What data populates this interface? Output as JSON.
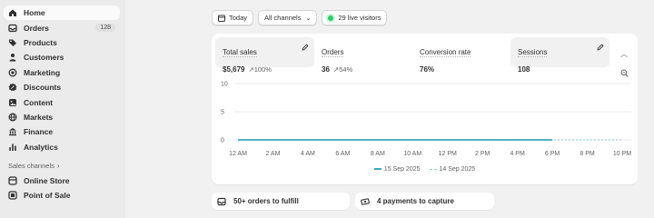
{
  "sidebar": {
    "items": [
      {
        "label": "Home",
        "icon": "home-icon",
        "active": true
      },
      {
        "label": "Orders",
        "icon": "orders-icon",
        "badge": "128"
      },
      {
        "label": "Products",
        "icon": "tag-icon"
      },
      {
        "label": "Customers",
        "icon": "person-icon"
      },
      {
        "label": "Marketing",
        "icon": "target-icon"
      },
      {
        "label": "Discounts",
        "icon": "discount-icon"
      },
      {
        "label": "Content",
        "icon": "content-icon"
      },
      {
        "label": "Markets",
        "icon": "globe-icon"
      },
      {
        "label": "Finance",
        "icon": "bank-icon"
      },
      {
        "label": "Analytics",
        "icon": "bar-chart-icon"
      }
    ],
    "sales_channels_label": "Sales channels",
    "channels": [
      {
        "label": "Online Store",
        "icon": "store-icon"
      },
      {
        "label": "Point of Sale",
        "icon": "pos-icon"
      }
    ]
  },
  "toolbar": {
    "date_label": "Today",
    "channels_label": "All channels",
    "live_label": "29 live visitors"
  },
  "metrics": [
    {
      "title": "Total sales",
      "value": "$5,679",
      "change": "100%"
    },
    {
      "title": "Orders",
      "value": "36",
      "change": "54%"
    },
    {
      "title": "Conversion rate",
      "value": "76%",
      "change": ""
    },
    {
      "title": "Sessions",
      "value": "108",
      "change": ""
    }
  ],
  "chart_data": {
    "type": "line",
    "x": [
      "12 AM",
      "2 AM",
      "4 AM",
      "6 AM",
      "8 AM",
      "10 AM",
      "12 PM",
      "2 PM",
      "4 PM",
      "6 PM",
      "8 PM",
      "10 PM"
    ],
    "yticks": [
      10,
      5,
      0
    ],
    "ylim": [
      0,
      10
    ],
    "series": [
      {
        "name": "15 Sep 2025",
        "values": [
          0,
          0,
          0,
          0,
          0,
          0,
          0,
          0,
          0,
          0
        ],
        "color": "#3eaab8",
        "style": "solid"
      },
      {
        "name": "14 Sep 2025",
        "values": [
          0,
          0,
          0,
          0,
          0,
          0,
          0,
          0,
          0,
          0,
          0,
          0
        ],
        "color": "#9ed5dc",
        "style": "dashed"
      }
    ],
    "grid": true,
    "legend": "bottom-center"
  },
  "bottom_cards": [
    {
      "label": "50+ orders to fulfill",
      "icon": "inbox-icon"
    },
    {
      "label": "4 payments to capture",
      "icon": "cash-icon"
    }
  ]
}
